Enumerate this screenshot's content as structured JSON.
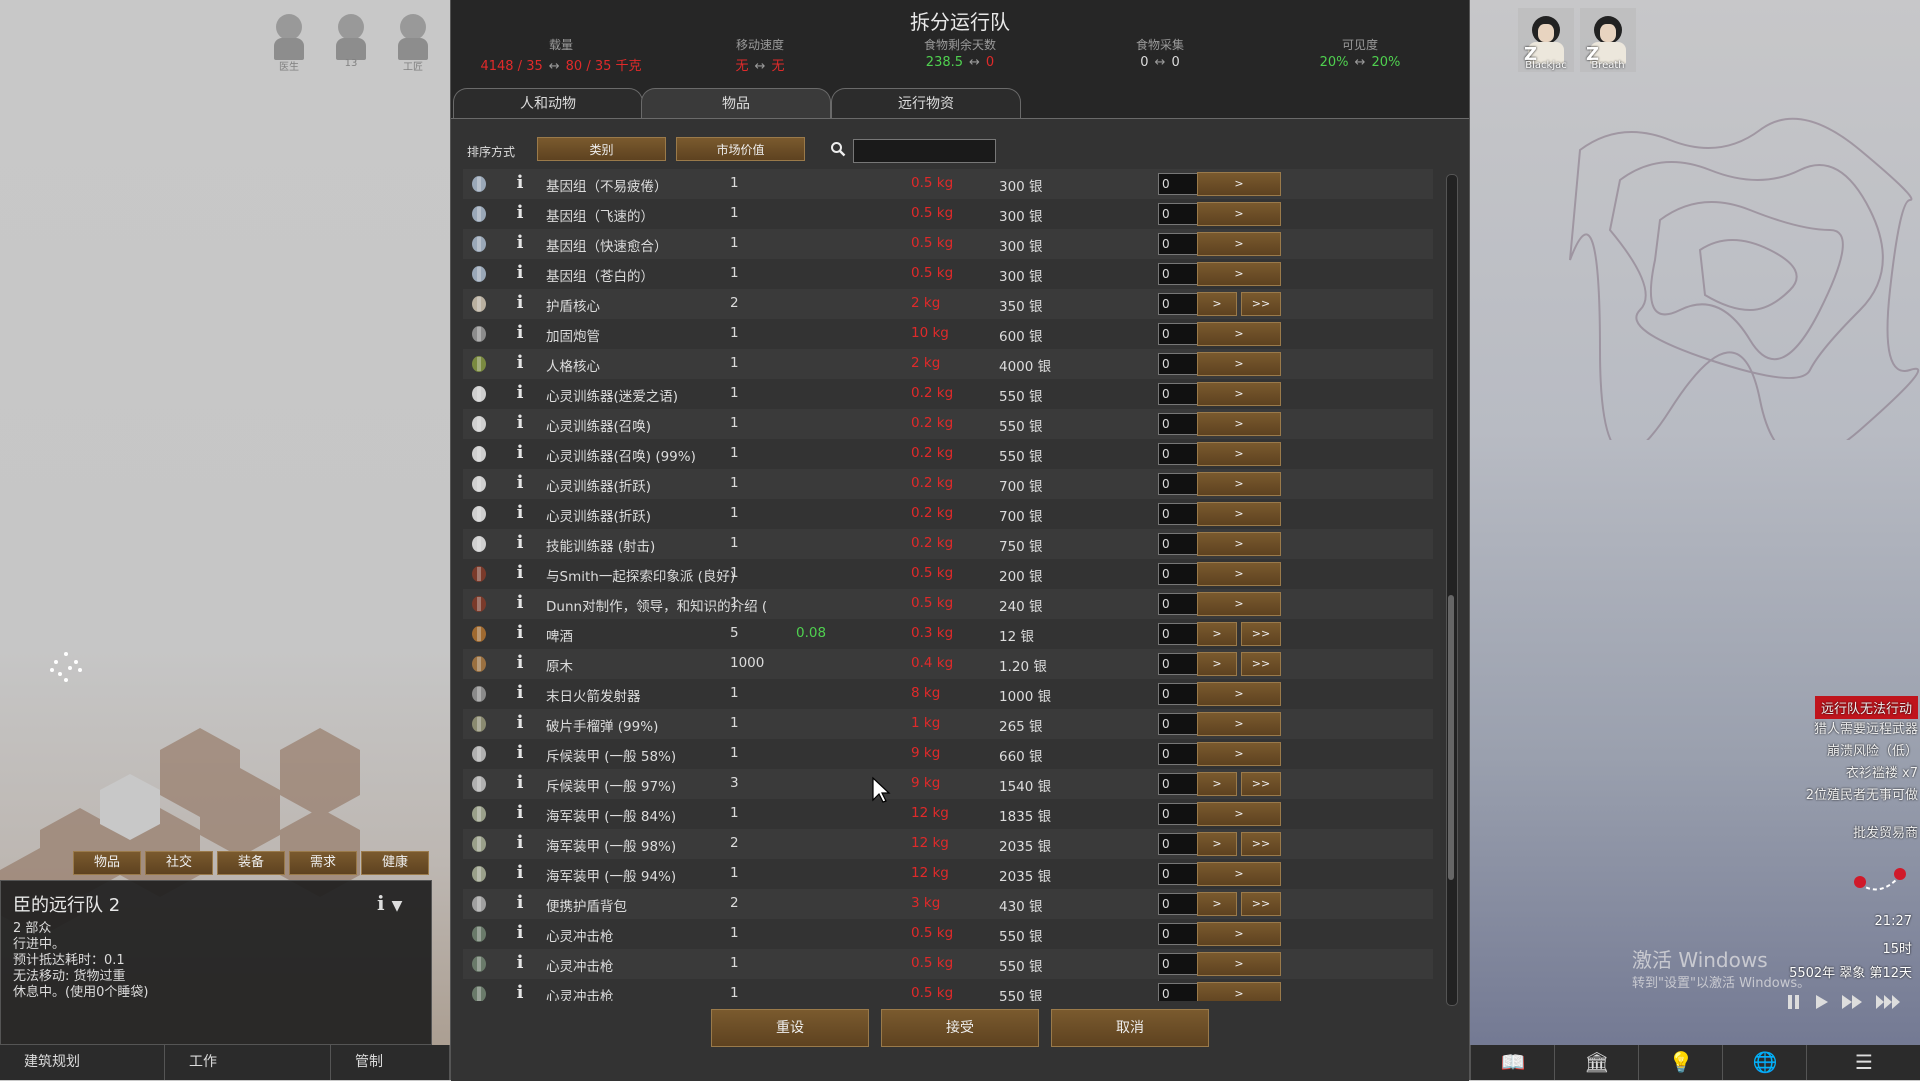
{
  "dialog": {
    "title": "拆分运行队",
    "stats": [
      {
        "label": "载量",
        "left": "4148 / 35",
        "right": "80 / 35 千克",
        "color": "#e02a2a"
      },
      {
        "label": "移动速度",
        "left": "无",
        "right": "无",
        "color": "#e02a2a"
      },
      {
        "label": "食物剩余天数",
        "left": "238.5",
        "right": "0",
        "left_color": "#4fd04f",
        "color": "#e02a2a"
      },
      {
        "label": "食物采集",
        "left": "0",
        "right": "0",
        "color": "#dcdcdc"
      },
      {
        "label": "可见度",
        "left": "20%",
        "right": "20%",
        "color": "#4fd04f"
      }
    ],
    "arrow": "↔",
    "tabs": [
      "人和动物",
      "物品",
      "远行物资"
    ],
    "active_tab": 1,
    "sort_label": "排序方式",
    "sort_buttons": [
      "类别",
      "市场价值"
    ],
    "search_placeholder": "",
    "rows": [
      {
        "name": "基因组（不易疲倦）",
        "count": "1",
        "extra": "",
        "weight": "0.5 kg",
        "value": "300 银",
        "qty": "0",
        "double": false,
        "icon": "genepack-icon"
      },
      {
        "name": "基因组（飞速的）",
        "count": "1",
        "extra": "",
        "weight": "0.5 kg",
        "value": "300 银",
        "qty": "0",
        "double": false,
        "icon": "genepack-icon"
      },
      {
        "name": "基因组（快速愈合）",
        "count": "1",
        "extra": "",
        "weight": "0.5 kg",
        "value": "300 银",
        "qty": "0",
        "double": false,
        "icon": "genepack-icon"
      },
      {
        "name": "基因组（苍白的）",
        "count": "1",
        "extra": "",
        "weight": "0.5 kg",
        "value": "300 银",
        "qty": "0",
        "double": false,
        "icon": "genepack-icon"
      },
      {
        "name": "护盾核心",
        "count": "2",
        "extra": "",
        "weight": "2 kg",
        "value": "350 银",
        "qty": "0",
        "double": true,
        "icon": "shield-core-icon"
      },
      {
        "name": "加固炮管",
        "count": "1",
        "extra": "",
        "weight": "10 kg",
        "value": "600 银",
        "qty": "0",
        "double": false,
        "icon": "barrel-icon"
      },
      {
        "name": "人格核心",
        "count": "1",
        "extra": "",
        "weight": "2 kg",
        "value": "4000 银",
        "qty": "0",
        "double": false,
        "icon": "persona-core-icon"
      },
      {
        "name": "心灵训练器(迷爱之语)",
        "count": "1",
        "extra": "",
        "weight": "0.2 kg",
        "value": "550 银",
        "qty": "0",
        "double": false,
        "icon": "neuroformer-icon"
      },
      {
        "name": "心灵训练器(召唤)",
        "count": "1",
        "extra": "",
        "weight": "0.2 kg",
        "value": "550 银",
        "qty": "0",
        "double": false,
        "icon": "neuroformer-icon"
      },
      {
        "name": "心灵训练器(召唤) (99%)",
        "count": "1",
        "extra": "",
        "weight": "0.2 kg",
        "value": "550 银",
        "qty": "0",
        "double": false,
        "icon": "neuroformer-icon"
      },
      {
        "name": "心灵训练器(折跃)",
        "count": "1",
        "extra": "",
        "weight": "0.2 kg",
        "value": "700 银",
        "qty": "0",
        "double": false,
        "icon": "neuroformer-icon"
      },
      {
        "name": "心灵训练器(折跃)",
        "count": "1",
        "extra": "",
        "weight": "0.2 kg",
        "value": "700 银",
        "qty": "0",
        "double": false,
        "icon": "neuroformer-icon"
      },
      {
        "name": "技能训练器 (射击)",
        "count": "1",
        "extra": "",
        "weight": "0.2 kg",
        "value": "750 银",
        "qty": "0",
        "double": false,
        "icon": "neuroformer-icon"
      },
      {
        "name": "与Smith一起探索印象派 (良好)",
        "count": "1",
        "extra": "",
        "weight": "0.5 kg",
        "value": "200 银",
        "qty": "0",
        "double": false,
        "icon": "book-icon"
      },
      {
        "name": "Dunn对制作，领导，和知识的介绍 (",
        "count": "1",
        "extra": "",
        "weight": "0.5 kg",
        "value": "240 银",
        "qty": "0",
        "double": false,
        "icon": "book-icon"
      },
      {
        "name": "啤酒",
        "count": "5",
        "extra": "0.08",
        "weight": "0.3 kg",
        "value": "12 银",
        "qty": "0",
        "double": true,
        "icon": "beer-icon"
      },
      {
        "name": "原木",
        "count": "1000",
        "extra": "",
        "weight": "0.4 kg",
        "value": "1.20 银",
        "qty": "0",
        "double": true,
        "icon": "wood-icon"
      },
      {
        "name": "末日火箭发射器",
        "count": "1",
        "extra": "",
        "weight": "8 kg",
        "value": "1000 银",
        "qty": "0",
        "double": false,
        "icon": "rocket-launcher-icon"
      },
      {
        "name": "破片手榴弹 (99%)",
        "count": "1",
        "extra": "",
        "weight": "1 kg",
        "value": "265 银",
        "qty": "0",
        "double": false,
        "icon": "grenade-icon"
      },
      {
        "name": "斥候装甲 (一般 58%)",
        "count": "1",
        "extra": "",
        "weight": "9 kg",
        "value": "660 银",
        "qty": "0",
        "double": false,
        "icon": "armor-icon"
      },
      {
        "name": "斥候装甲 (一般 97%)",
        "count": "3",
        "extra": "",
        "weight": "9 kg",
        "value": "1540 银",
        "qty": "0",
        "double": true,
        "icon": "armor-icon"
      },
      {
        "name": "海军装甲 (一般 84%)",
        "count": "1",
        "extra": "",
        "weight": "12 kg",
        "value": "1835 银",
        "qty": "0",
        "double": false,
        "icon": "marine-armor-icon"
      },
      {
        "name": "海军装甲 (一般 98%)",
        "count": "2",
        "extra": "",
        "weight": "12 kg",
        "value": "2035 银",
        "qty": "0",
        "double": true,
        "icon": "marine-armor-icon"
      },
      {
        "name": "海军装甲 (一般 94%)",
        "count": "1",
        "extra": "",
        "weight": "12 kg",
        "value": "2035 银",
        "qty": "0",
        "double": false,
        "icon": "marine-armor-icon"
      },
      {
        "name": "便携护盾背包",
        "count": "2",
        "extra": "",
        "weight": "3 kg",
        "value": "430 银",
        "qty": "0",
        "double": true,
        "icon": "shield-pack-icon"
      },
      {
        "name": "心灵冲击枪",
        "count": "1",
        "extra": "",
        "weight": "0.5 kg",
        "value": "550 银",
        "qty": "0",
        "double": false,
        "icon": "psychic-lance-icon"
      },
      {
        "name": "心灵冲击枪",
        "count": "1",
        "extra": "",
        "weight": "0.5 kg",
        "value": "550 银",
        "qty": "0",
        "double": false,
        "icon": "psychic-lance-icon"
      },
      {
        "name": "心灵冲击枪",
        "count": "1",
        "extra": "",
        "weight": "0.5 kg",
        "value": "550 银",
        "qty": "0",
        "double": false,
        "icon": "psychic-lance-icon"
      }
    ],
    "transfer_single": ">",
    "transfer_all": ">>",
    "buttons": {
      "reset": "重设",
      "accept": "接受",
      "cancel": "取消"
    }
  },
  "top_colonists": [
    "医生",
    "13",
    "工匠"
  ],
  "sleeping_colonists": [
    "Blackjac",
    "Breath"
  ],
  "sleep_mark": "Z",
  "left_tabs": [
    "物品",
    "社交",
    "装备",
    "需求",
    "健康"
  ],
  "caravan": {
    "title": "臣的远行队 2",
    "lines": [
      "2 部众",
      "行进中。",
      "预计抵达耗时：0.1",
      "无法移动: 货物过重",
      "休息中。(使用0个睡袋)"
    ]
  },
  "bottom_bar": [
    "建筑规划",
    "工作",
    "管制"
  ],
  "alerts": [
    "远行队无法行动",
    "猎人需要远程武器",
    "崩溃风险（低）",
    "衣衫褴褛 x7",
    "2位殖民者无事可做",
    "批发贸易商"
  ],
  "clock": {
    "time": "21:27",
    "hour": "15时",
    "date": "5502年 翠象 第12天"
  },
  "watermark": {
    "line1": "激活 Windows",
    "line2": "转到\"设置\"以激活 Windows。"
  },
  "right_bar_icons": [
    "book-icon",
    "factions-icon",
    "lightbulb-icon",
    "world-icon",
    "menu-icon"
  ]
}
